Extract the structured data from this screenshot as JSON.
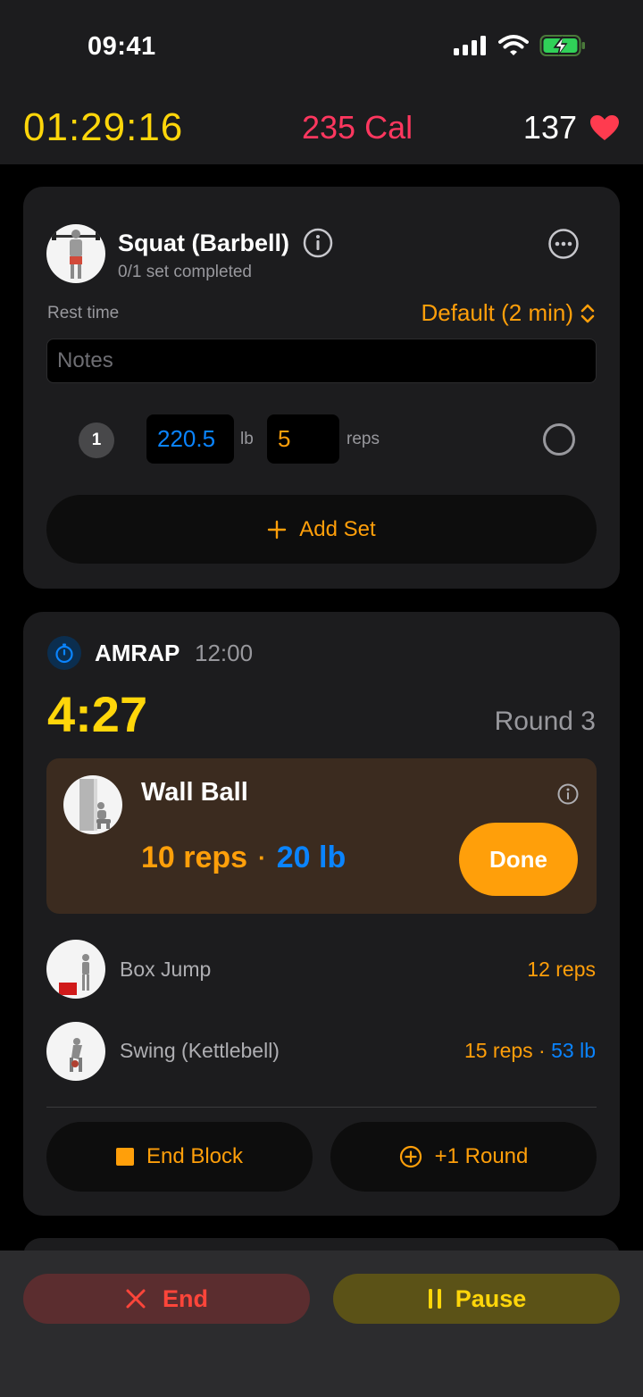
{
  "status_bar": {
    "time": "09:41"
  },
  "header": {
    "elapsed": "01:29:16",
    "calories": "235 Cal",
    "heart_rate": "137"
  },
  "exercise_card": {
    "name": "Squat (Barbell)",
    "progress": "0/1 set completed",
    "rest_label": "Rest time",
    "rest_value": "Default (2 min)",
    "notes_placeholder": "Notes",
    "sets": [
      {
        "number": "1",
        "weight": "220.5",
        "weight_unit": "lb",
        "reps": "5",
        "reps_unit": "reps",
        "completed": false
      }
    ],
    "add_set_label": "Add Set"
  },
  "amrap_card": {
    "label": "AMRAP",
    "duration": "12:00",
    "countdown": "4:27",
    "round": "Round 3",
    "current": {
      "name": "Wall Ball",
      "reps": "10 reps",
      "separator": "·",
      "weight": "20 lb",
      "done_label": "Done"
    },
    "exercises": [
      {
        "name": "Box Jump",
        "reps": "12 reps",
        "separator": "",
        "weight": ""
      },
      {
        "name": "Swing (Kettlebell)",
        "reps": "15 reps",
        "separator": " · ",
        "weight": "53 lb"
      }
    ],
    "end_block_label": "End Block",
    "plus_round_label": "+1 Round"
  },
  "bottom": {
    "end_label": "End",
    "pause_label": "Pause"
  },
  "colors": {
    "accent_orange": "#ff9f0a",
    "accent_blue": "#0a84ff",
    "accent_yellow": "#ffd60a",
    "accent_red": "#ff453a",
    "calorie_pink": "#ff375f"
  },
  "icons": [
    "signal-icon",
    "wifi-icon",
    "battery-charging-icon",
    "heart-icon",
    "info-icon",
    "more-icon",
    "chevron-updown-icon",
    "plus-icon",
    "timer-icon",
    "stop-icon",
    "plus-circle-icon",
    "close-icon",
    "pause-icon"
  ]
}
